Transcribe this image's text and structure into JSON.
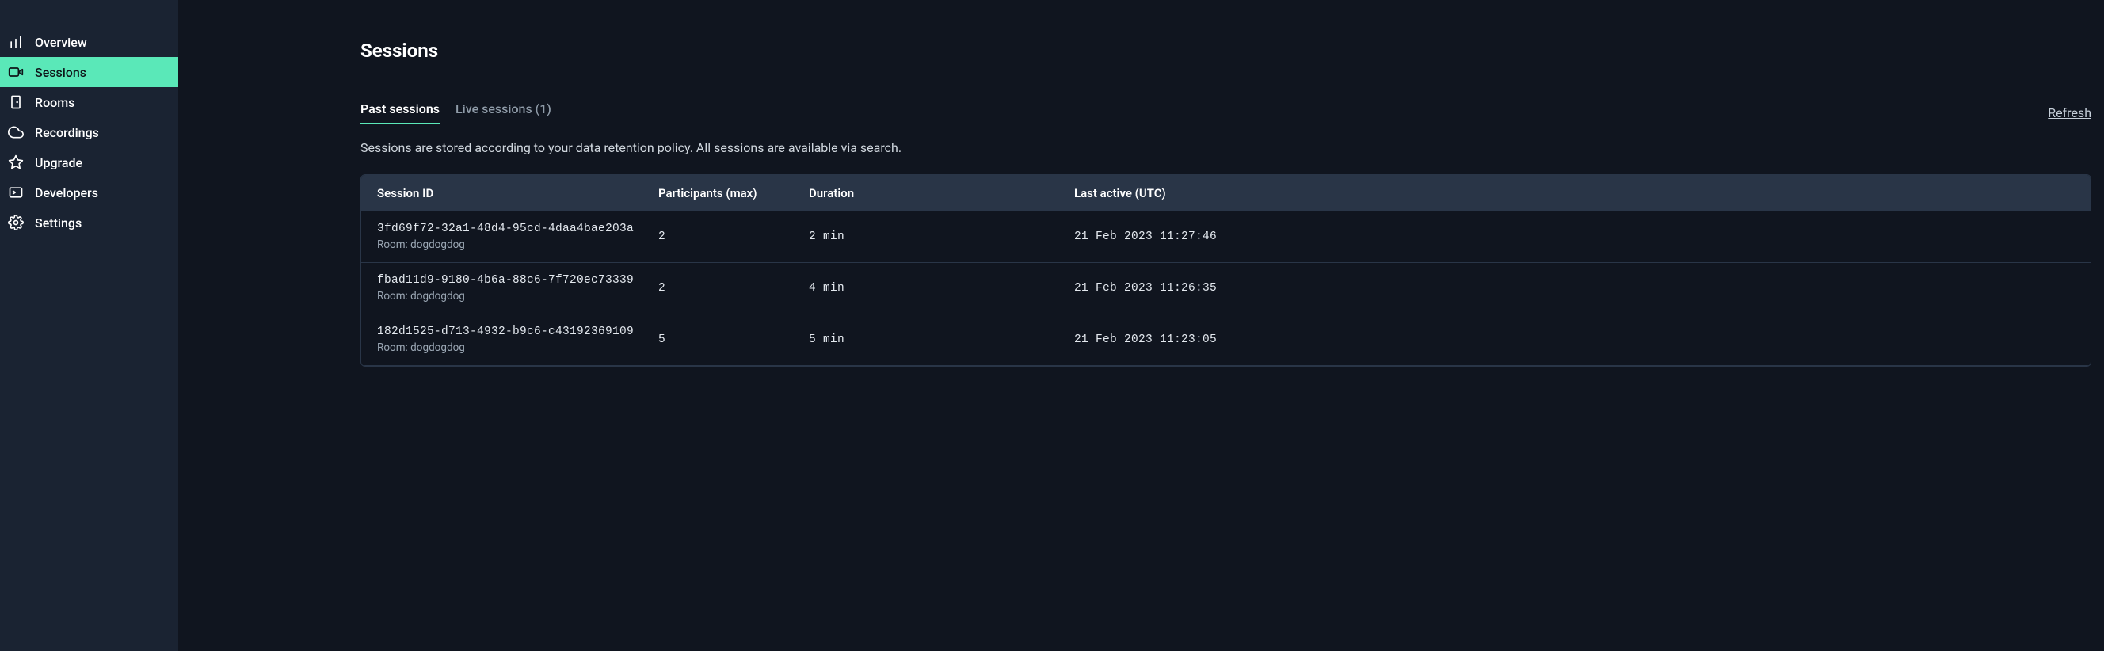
{
  "sidebar": {
    "items": [
      {
        "label": "Overview"
      },
      {
        "label": "Sessions"
      },
      {
        "label": "Rooms"
      },
      {
        "label": "Recordings"
      },
      {
        "label": "Upgrade"
      },
      {
        "label": "Developers"
      },
      {
        "label": "Settings"
      }
    ]
  },
  "page": {
    "title": "Sessions",
    "info": "Sessions are stored according to your data retention policy. All sessions are available via search."
  },
  "tabs": {
    "past": "Past sessions",
    "live": "Live sessions (1)"
  },
  "actions": {
    "refresh": "Refresh"
  },
  "table": {
    "headers": {
      "session_id": "Session ID",
      "participants": "Participants (max)",
      "duration": "Duration",
      "last_active": "Last active (UTC)"
    },
    "rows": [
      {
        "id": "3fd69f72-32a1-48d4-95cd-4daa4bae203a",
        "room": "Room: dogdogdog",
        "participants": "2",
        "duration": "2 min",
        "last_active": "21 Feb 2023 11:27:46"
      },
      {
        "id": "fbad11d9-9180-4b6a-88c6-7f720ec73339",
        "room": "Room: dogdogdog",
        "participants": "2",
        "duration": "4 min",
        "last_active": "21 Feb 2023 11:26:35"
      },
      {
        "id": "182d1525-d713-4932-b9c6-c43192369109",
        "room": "Room: dogdogdog",
        "participants": "5",
        "duration": "5 min",
        "last_active": "21 Feb 2023 11:23:05"
      }
    ]
  }
}
